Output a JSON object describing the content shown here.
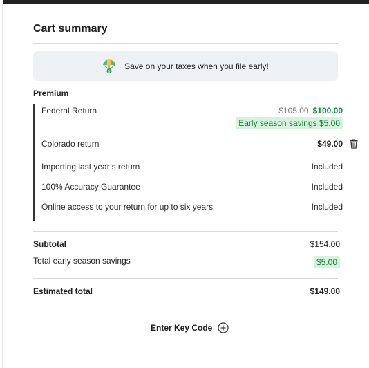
{
  "cart": {
    "title": "Cart summary",
    "promo_text": "Save on your taxes when you file early!",
    "promo_icon": "parachute-money-icon",
    "section_label": "Premium",
    "items": [
      {
        "label": "Federal Return",
        "original_price": "$105.00",
        "price": "$100.00",
        "savings_badge": "Early season savings $5.00"
      },
      {
        "label": "Colorado return",
        "price": "$49.00",
        "action_icon": "trash-icon"
      },
      {
        "label": "Importing last year’s return",
        "price": "Included"
      },
      {
        "label": "100% Accuracy Guarantee",
        "price": "Included"
      },
      {
        "label": "Online access to your return for up to six years",
        "price": "Included"
      }
    ],
    "subtotal_label": "Subtotal",
    "subtotal_value": "$154.00",
    "savings_label": "Total early season savings",
    "savings_value": "$5.00",
    "total_label": "Estimated total",
    "total_value": "$149.00",
    "key_code_label": "Enter Key Code",
    "key_code_icon": "plus-circle-icon"
  },
  "colors": {
    "accent_green": "#0b8a3b",
    "badge_bg": "#d6f2dc",
    "promo_bg": "#eef1f4"
  }
}
